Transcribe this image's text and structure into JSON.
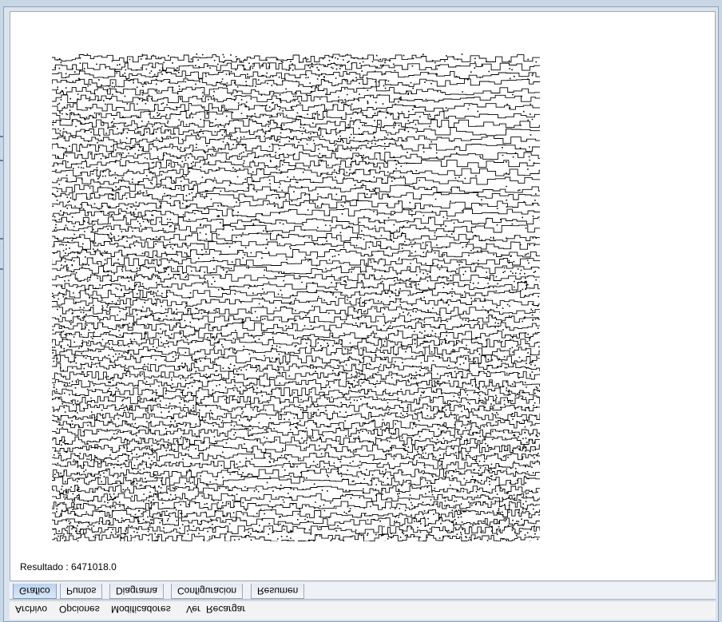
{
  "window": {
    "result_text": "Resultado : 6471018.0"
  },
  "tabs": [
    {
      "label": "Grafico",
      "active": true
    },
    {
      "label": "Puntos",
      "active": false
    },
    {
      "label": "Diagrama",
      "active": false
    },
    {
      "label": "Configuracion",
      "active": false
    },
    {
      "label": "Resumen",
      "active": false
    }
  ],
  "menu": [
    {
      "label": "Archivo"
    },
    {
      "label": "Opciones"
    },
    {
      "label": "Modificadores"
    },
    {
      "label": "Ver"
    },
    {
      "label": "Recargar"
    }
  ],
  "colors": {
    "accent": "#bcd3ee",
    "plot_ink": "#000000",
    "plot_background": "#ffffff"
  }
}
